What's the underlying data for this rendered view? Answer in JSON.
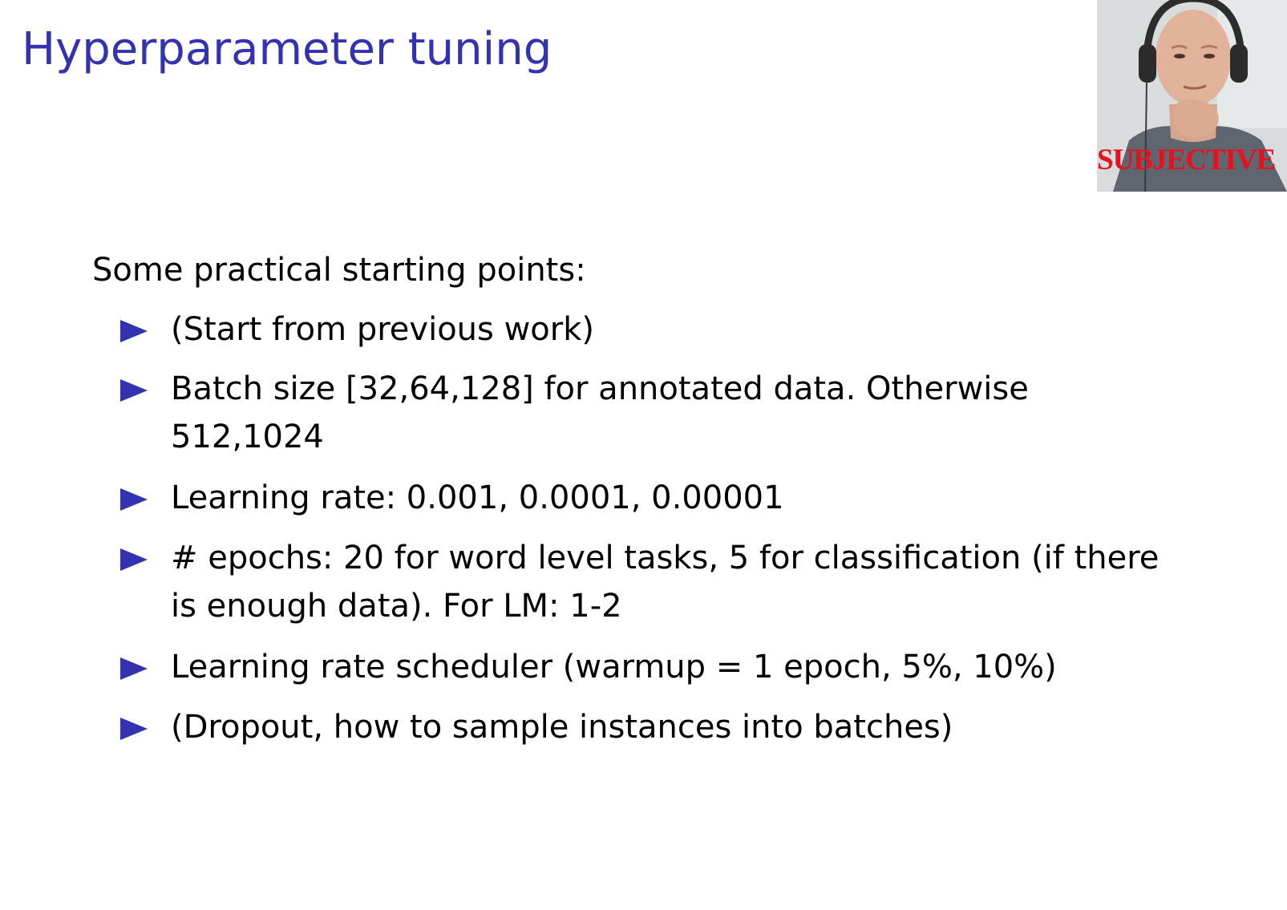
{
  "slide": {
    "title": "Hyperparameter tuning",
    "intro": "Some practical starting points:",
    "bullets": [
      {
        "line1": "(Start from previous work)",
        "line2": ""
      },
      {
        "line1": "Batch size [32,64,128] for annotated data.  Otherwise",
        "line2": "512,1024"
      },
      {
        "line1": "Learning rate:  0.001, 0.0001, 0.00001",
        "line2": ""
      },
      {
        "line1": "# epochs:  20 for word level tasks, 5 for classification (if there",
        "line2": "is enough data).  For LM: 1-2"
      },
      {
        "line1": "Learning rate scheduler (warmup = 1 epoch, 5%, 10%)",
        "line2": ""
      },
      {
        "line1": "(Dropout, how to sample instances into batches)",
        "line2": ""
      }
    ]
  },
  "webcam": {
    "label": "SUBJECTIVE"
  },
  "colors": {
    "title": "#3333b2",
    "bullet_marker": "#3333b2",
    "webcam_label": "#e8101a"
  }
}
